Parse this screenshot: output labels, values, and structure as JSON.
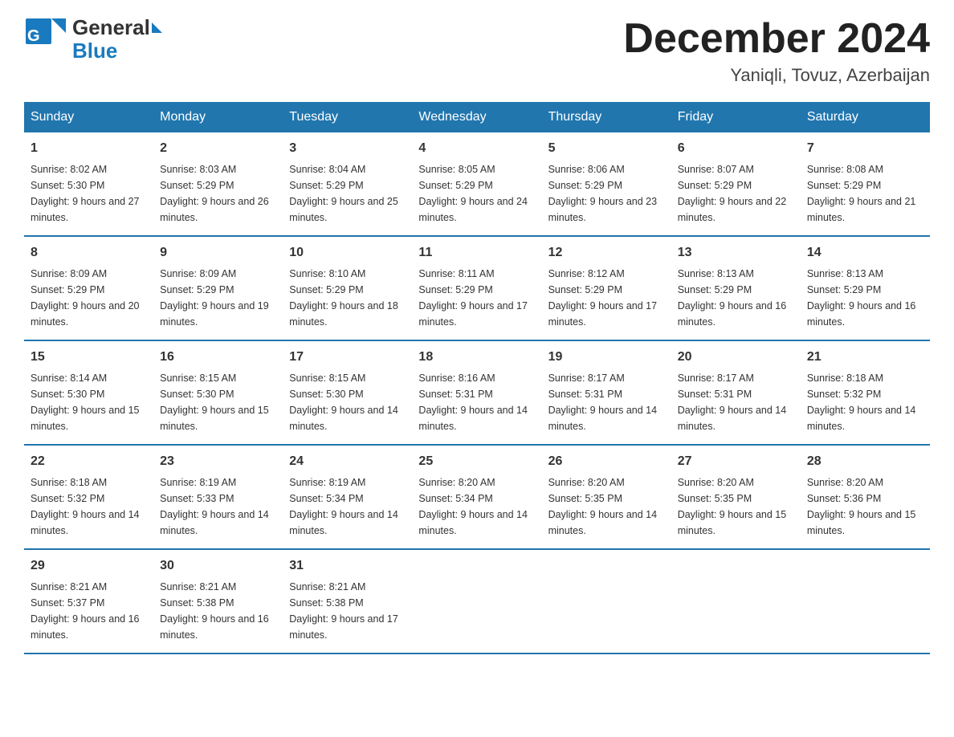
{
  "header": {
    "logo_text_main": "General",
    "logo_text_blue": "Blue",
    "month_title": "December 2024",
    "location": "Yaniqli, Tovuz, Azerbaijan"
  },
  "weekdays": [
    "Sunday",
    "Monday",
    "Tuesday",
    "Wednesday",
    "Thursday",
    "Friday",
    "Saturday"
  ],
  "weeks": [
    [
      {
        "day": "1",
        "sunrise": "Sunrise: 8:02 AM",
        "sunset": "Sunset: 5:30 PM",
        "daylight": "Daylight: 9 hours and 27 minutes."
      },
      {
        "day": "2",
        "sunrise": "Sunrise: 8:03 AM",
        "sunset": "Sunset: 5:29 PM",
        "daylight": "Daylight: 9 hours and 26 minutes."
      },
      {
        "day": "3",
        "sunrise": "Sunrise: 8:04 AM",
        "sunset": "Sunset: 5:29 PM",
        "daylight": "Daylight: 9 hours and 25 minutes."
      },
      {
        "day": "4",
        "sunrise": "Sunrise: 8:05 AM",
        "sunset": "Sunset: 5:29 PM",
        "daylight": "Daylight: 9 hours and 24 minutes."
      },
      {
        "day": "5",
        "sunrise": "Sunrise: 8:06 AM",
        "sunset": "Sunset: 5:29 PM",
        "daylight": "Daylight: 9 hours and 23 minutes."
      },
      {
        "day": "6",
        "sunrise": "Sunrise: 8:07 AM",
        "sunset": "Sunset: 5:29 PM",
        "daylight": "Daylight: 9 hours and 22 minutes."
      },
      {
        "day": "7",
        "sunrise": "Sunrise: 8:08 AM",
        "sunset": "Sunset: 5:29 PM",
        "daylight": "Daylight: 9 hours and 21 minutes."
      }
    ],
    [
      {
        "day": "8",
        "sunrise": "Sunrise: 8:09 AM",
        "sunset": "Sunset: 5:29 PM",
        "daylight": "Daylight: 9 hours and 20 minutes."
      },
      {
        "day": "9",
        "sunrise": "Sunrise: 8:09 AM",
        "sunset": "Sunset: 5:29 PM",
        "daylight": "Daylight: 9 hours and 19 minutes."
      },
      {
        "day": "10",
        "sunrise": "Sunrise: 8:10 AM",
        "sunset": "Sunset: 5:29 PM",
        "daylight": "Daylight: 9 hours and 18 minutes."
      },
      {
        "day": "11",
        "sunrise": "Sunrise: 8:11 AM",
        "sunset": "Sunset: 5:29 PM",
        "daylight": "Daylight: 9 hours and 17 minutes."
      },
      {
        "day": "12",
        "sunrise": "Sunrise: 8:12 AM",
        "sunset": "Sunset: 5:29 PM",
        "daylight": "Daylight: 9 hours and 17 minutes."
      },
      {
        "day": "13",
        "sunrise": "Sunrise: 8:13 AM",
        "sunset": "Sunset: 5:29 PM",
        "daylight": "Daylight: 9 hours and 16 minutes."
      },
      {
        "day": "14",
        "sunrise": "Sunrise: 8:13 AM",
        "sunset": "Sunset: 5:29 PM",
        "daylight": "Daylight: 9 hours and 16 minutes."
      }
    ],
    [
      {
        "day": "15",
        "sunrise": "Sunrise: 8:14 AM",
        "sunset": "Sunset: 5:30 PM",
        "daylight": "Daylight: 9 hours and 15 minutes."
      },
      {
        "day": "16",
        "sunrise": "Sunrise: 8:15 AM",
        "sunset": "Sunset: 5:30 PM",
        "daylight": "Daylight: 9 hours and 15 minutes."
      },
      {
        "day": "17",
        "sunrise": "Sunrise: 8:15 AM",
        "sunset": "Sunset: 5:30 PM",
        "daylight": "Daylight: 9 hours and 14 minutes."
      },
      {
        "day": "18",
        "sunrise": "Sunrise: 8:16 AM",
        "sunset": "Sunset: 5:31 PM",
        "daylight": "Daylight: 9 hours and 14 minutes."
      },
      {
        "day": "19",
        "sunrise": "Sunrise: 8:17 AM",
        "sunset": "Sunset: 5:31 PM",
        "daylight": "Daylight: 9 hours and 14 minutes."
      },
      {
        "day": "20",
        "sunrise": "Sunrise: 8:17 AM",
        "sunset": "Sunset: 5:31 PM",
        "daylight": "Daylight: 9 hours and 14 minutes."
      },
      {
        "day": "21",
        "sunrise": "Sunrise: 8:18 AM",
        "sunset": "Sunset: 5:32 PM",
        "daylight": "Daylight: 9 hours and 14 minutes."
      }
    ],
    [
      {
        "day": "22",
        "sunrise": "Sunrise: 8:18 AM",
        "sunset": "Sunset: 5:32 PM",
        "daylight": "Daylight: 9 hours and 14 minutes."
      },
      {
        "day": "23",
        "sunrise": "Sunrise: 8:19 AM",
        "sunset": "Sunset: 5:33 PM",
        "daylight": "Daylight: 9 hours and 14 minutes."
      },
      {
        "day": "24",
        "sunrise": "Sunrise: 8:19 AM",
        "sunset": "Sunset: 5:34 PM",
        "daylight": "Daylight: 9 hours and 14 minutes."
      },
      {
        "day": "25",
        "sunrise": "Sunrise: 8:20 AM",
        "sunset": "Sunset: 5:34 PM",
        "daylight": "Daylight: 9 hours and 14 minutes."
      },
      {
        "day": "26",
        "sunrise": "Sunrise: 8:20 AM",
        "sunset": "Sunset: 5:35 PM",
        "daylight": "Daylight: 9 hours and 14 minutes."
      },
      {
        "day": "27",
        "sunrise": "Sunrise: 8:20 AM",
        "sunset": "Sunset: 5:35 PM",
        "daylight": "Daylight: 9 hours and 15 minutes."
      },
      {
        "day": "28",
        "sunrise": "Sunrise: 8:20 AM",
        "sunset": "Sunset: 5:36 PM",
        "daylight": "Daylight: 9 hours and 15 minutes."
      }
    ],
    [
      {
        "day": "29",
        "sunrise": "Sunrise: 8:21 AM",
        "sunset": "Sunset: 5:37 PM",
        "daylight": "Daylight: 9 hours and 16 minutes."
      },
      {
        "day": "30",
        "sunrise": "Sunrise: 8:21 AM",
        "sunset": "Sunset: 5:38 PM",
        "daylight": "Daylight: 9 hours and 16 minutes."
      },
      {
        "day": "31",
        "sunrise": "Sunrise: 8:21 AM",
        "sunset": "Sunset: 5:38 PM",
        "daylight": "Daylight: 9 hours and 17 minutes."
      },
      {
        "day": "",
        "sunrise": "",
        "sunset": "",
        "daylight": ""
      },
      {
        "day": "",
        "sunrise": "",
        "sunset": "",
        "daylight": ""
      },
      {
        "day": "",
        "sunrise": "",
        "sunset": "",
        "daylight": ""
      },
      {
        "day": "",
        "sunrise": "",
        "sunset": "",
        "daylight": ""
      }
    ]
  ]
}
